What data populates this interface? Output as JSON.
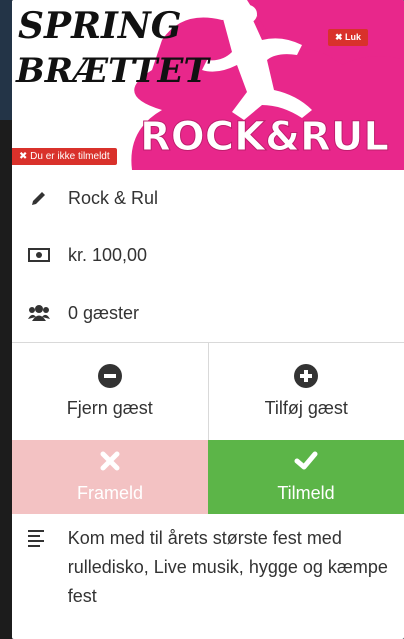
{
  "hero": {
    "logo_text_top": "SPRING",
    "logo_text_bottom": "BRÆTTET",
    "event_graphic_text": "ROCK&RUL",
    "close_label": "✖ Luk",
    "status_badge": "✖ Du er ikke tilmeldt"
  },
  "info": {
    "name": "Rock & Rul",
    "price": "kr. 100,00",
    "guests": "0 gæster"
  },
  "guest_actions": {
    "remove_label": "Fjern gæst",
    "add_label": "Tilføj gæst"
  },
  "actions": {
    "decline_label": "Frameld",
    "accept_label": "Tilmeld"
  },
  "description": "Kom med til årets største fest med rulledisko, Live musik, hygge og kæmpe fest",
  "colors": {
    "magenta": "#e8278b",
    "danger": "#d9312b",
    "success": "#5cb548",
    "decline_bg": "#f3c2c3"
  }
}
